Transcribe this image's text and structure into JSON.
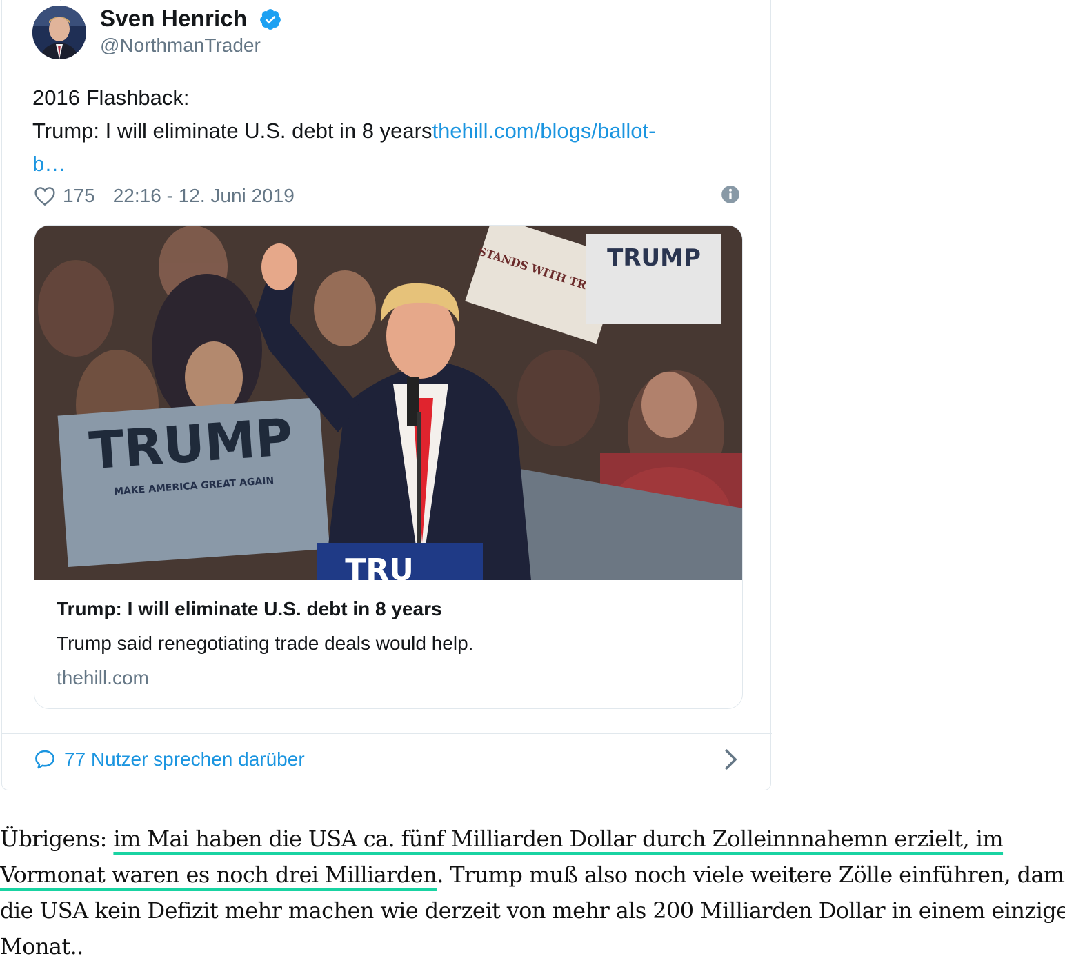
{
  "tweet": {
    "author_name": "Sven Henrich",
    "handle": "@NorthmanTrader",
    "text_line1": "2016 Flashback:",
    "text_line2": "Trump: I will eliminate U.S. debt in 8 years",
    "link_part1": "thehill.com/blogs/ballot-",
    "link_part2": "b…",
    "likes": "175",
    "timestamp": "22:16 - 12. Juni 2019",
    "card": {
      "title": "Trump: I will eliminate U.S. debt in 8 years",
      "description": "Trump said renegotiating trade deals would help.",
      "domain": "thehill.com",
      "image_sign_text": "TRUMP",
      "image_sign_text2": "STANDS WITH TRUMP",
      "image_sign_small": "MAKE AMERICA GREAT AGAIN"
    },
    "conversation": "77 Nutzer sprechen darüber",
    "icons": [
      "verified-badge-icon",
      "heart-icon",
      "info-icon",
      "speech-bubble-icon",
      "chevron-right-icon"
    ],
    "colors": {
      "link": "#1b95e0",
      "verified": "#1da1f2",
      "muted": "#657786"
    }
  },
  "article": {
    "line1_pre": "Übrigens: ",
    "line1_hl": "im Mai haben die USA ca. fünf Milliarden Dollar durch Zolleinnnahemn erzielt, im",
    "line2_hl": "Vormonat waren es noch drei Milliarden",
    "line2_post": ". Trump muß also noch viele weitere Zölle einführen, damit",
    "line3": "die USA kein Defizit mehr machen wie derzeit von mehr als 200 Milliarden Dollar in einem einzigen",
    "line4": "Monat..",
    "underline_color": "#19d3a2"
  }
}
